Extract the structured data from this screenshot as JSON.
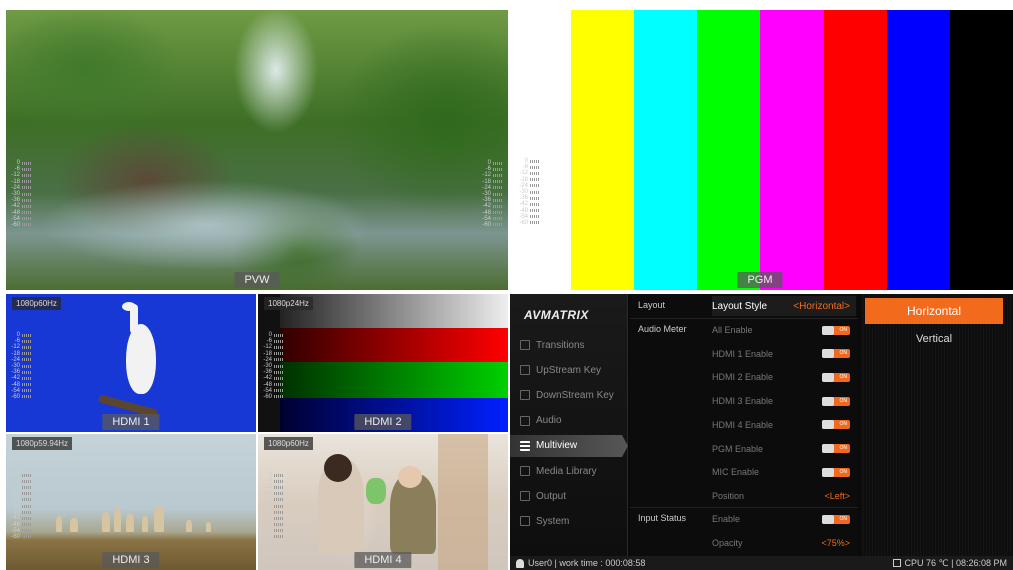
{
  "tiles": {
    "pvw": {
      "label": "PVW"
    },
    "pgm": {
      "label": "PGM",
      "bars": [
        "#ffff00",
        "#00ffff",
        "#00ff00",
        "#ff00ff",
        "#ff0000",
        "#0000ff",
        "#000000"
      ]
    },
    "hdmi1": {
      "label": "HDMI 1",
      "resolution": "1080p60Hz"
    },
    "hdmi2": {
      "label": "HDMI 2",
      "resolution": "1080p24Hz"
    },
    "hdmi3": {
      "label": "HDMI 3",
      "resolution": "1080p59.94Hz"
    },
    "hdmi4": {
      "label": "HDMI 4",
      "resolution": "1080p60Hz"
    }
  },
  "meter_scale": [
    "0",
    "-6",
    "-12",
    "-18",
    "-24",
    "-30",
    "-36",
    "-42",
    "-48",
    "-54",
    "-60"
  ],
  "menu": {
    "logo": "AVMATRIX",
    "nav": [
      {
        "label": "Transitions",
        "icon": "transitions-icon"
      },
      {
        "label": "UpStream Key",
        "icon": "upstream-key-icon"
      },
      {
        "label": "DownStream Key",
        "icon": "downstream-key-icon"
      },
      {
        "label": "Audio",
        "icon": "audio-icon"
      },
      {
        "label": "Multiview",
        "icon": "multiview-icon",
        "active": true
      },
      {
        "label": "Media Library",
        "icon": "media-library-icon"
      },
      {
        "label": "Output",
        "icon": "output-icon"
      },
      {
        "label": "System",
        "icon": "system-icon"
      }
    ],
    "sections": {
      "layout": "Layout",
      "audio_meter": "Audio Meter",
      "input_status": "Input Status"
    },
    "layout_style": {
      "label": "Layout Style",
      "value": "<Horizontal>"
    },
    "audio_rows": [
      {
        "label": "All Enable",
        "state": "ON"
      },
      {
        "label": "HDMI 1 Enable",
        "state": "ON"
      },
      {
        "label": "HDMI 2 Enable",
        "state": "ON"
      },
      {
        "label": "HDMI 3 Enable",
        "state": "ON"
      },
      {
        "label": "HDMI 4 Enable",
        "state": "ON"
      },
      {
        "label": "PGM Enable",
        "state": "ON"
      },
      {
        "label": "MIC Enable",
        "state": "ON"
      }
    ],
    "position": {
      "label": "Position",
      "value": "<Left>"
    },
    "input_enable": {
      "label": "Enable",
      "state": "ON"
    },
    "opacity": {
      "label": "Opacity",
      "value": "<75%>"
    },
    "options": [
      "Horizontal",
      "Vertical"
    ],
    "selected_option": "Horizontal",
    "accent": "#f26b1d"
  },
  "status": {
    "user": "User0 | work time : 000:08:58",
    "cpu": "CPU 76 ℃ | 08:26:08 PM"
  }
}
